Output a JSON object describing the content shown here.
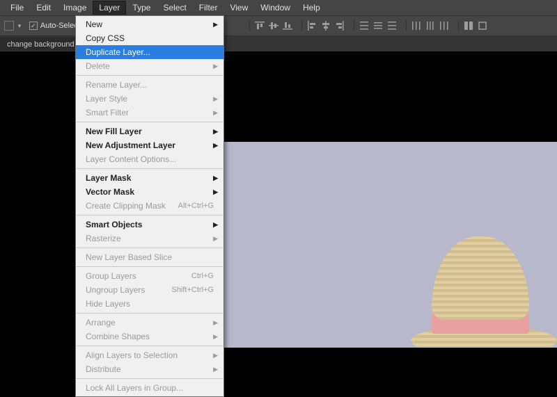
{
  "menubar": {
    "items": [
      "File",
      "Edit",
      "Image",
      "Layer",
      "Type",
      "Select",
      "Filter",
      "View",
      "Window",
      "Help"
    ],
    "active_index": 3
  },
  "toolbar": {
    "auto_select_label": "Auto-Select:"
  },
  "tab": {
    "title": "change background c"
  },
  "dropdown": {
    "groups": [
      [
        {
          "label": "New",
          "arrow": true
        },
        {
          "label": "Copy CSS"
        },
        {
          "label": "Duplicate Layer...",
          "selected": true
        },
        {
          "label": "Delete",
          "arrow": true,
          "disabled": true
        }
      ],
      [
        {
          "label": "Rename Layer...",
          "disabled": true
        },
        {
          "label": "Layer Style",
          "arrow": true,
          "disabled": true
        },
        {
          "label": "Smart Filter",
          "arrow": true,
          "disabled": true
        }
      ],
      [
        {
          "label": "New Fill Layer",
          "arrow": true,
          "bold": true
        },
        {
          "label": "New Adjustment Layer",
          "arrow": true,
          "bold": true
        },
        {
          "label": "Layer Content Options...",
          "disabled": true
        }
      ],
      [
        {
          "label": "Layer Mask",
          "arrow": true,
          "bold": true
        },
        {
          "label": "Vector Mask",
          "arrow": true,
          "bold": true
        },
        {
          "label": "Create Clipping Mask",
          "shortcut": "Alt+Ctrl+G",
          "disabled": true
        }
      ],
      [
        {
          "label": "Smart Objects",
          "arrow": true,
          "bold": true
        },
        {
          "label": "Rasterize",
          "arrow": true,
          "disabled": true
        }
      ],
      [
        {
          "label": "New Layer Based Slice",
          "disabled": true
        }
      ],
      [
        {
          "label": "Group Layers",
          "shortcut": "Ctrl+G",
          "disabled": true
        },
        {
          "label": "Ungroup Layers",
          "shortcut": "Shift+Ctrl+G",
          "disabled": true
        },
        {
          "label": "Hide Layers",
          "disabled": true
        }
      ],
      [
        {
          "label": "Arrange",
          "arrow": true,
          "disabled": true
        },
        {
          "label": "Combine Shapes",
          "arrow": true,
          "disabled": true
        }
      ],
      [
        {
          "label": "Align Layers to Selection",
          "arrow": true,
          "disabled": true
        },
        {
          "label": "Distribute",
          "arrow": true,
          "disabled": true
        }
      ],
      [
        {
          "label": "Lock All Layers in Group...",
          "disabled": true
        }
      ]
    ]
  }
}
